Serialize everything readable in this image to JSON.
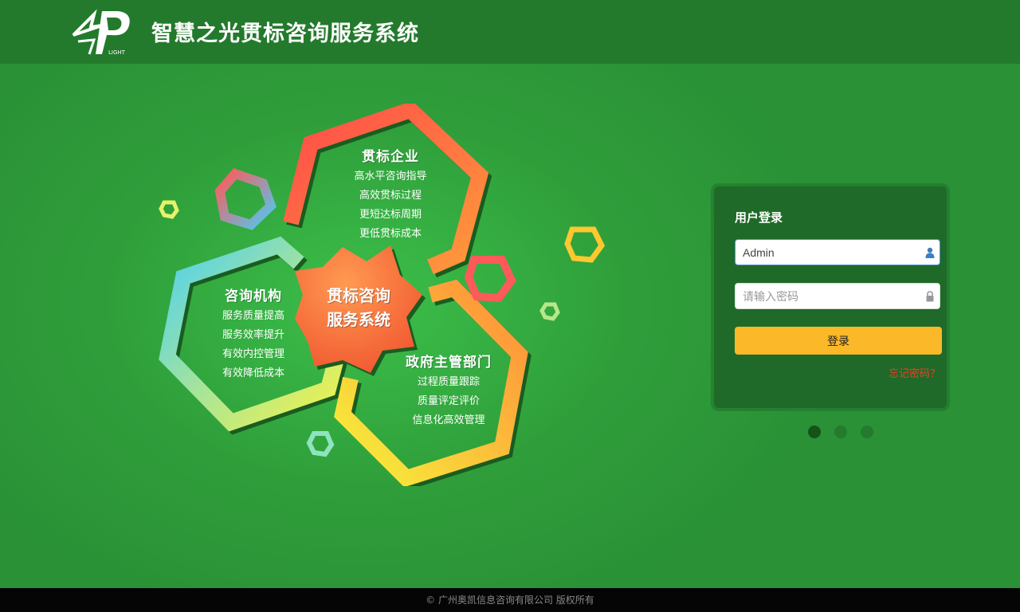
{
  "header": {
    "title": "智慧之光贯标咨询服务系统",
    "logo_text": "LIGHT"
  },
  "illustration": {
    "center": [
      "贯标咨询",
      "服务系统"
    ],
    "groups": [
      {
        "title": "贯标企业",
        "items": [
          "高水平咨询指导",
          "高效贯标过程",
          "更短达标周期",
          "更低贯标成本"
        ]
      },
      {
        "title": "咨询机构",
        "items": [
          "服务质量提高",
          "服务效率提升",
          "有效内控管理",
          "有效降低成本"
        ]
      },
      {
        "title": "政府主管部门",
        "items": [
          "过程质量跟踪",
          "质量评定评价",
          "信息化高效管理"
        ]
      }
    ]
  },
  "login": {
    "title": "用户登录",
    "username_value": "Admin",
    "username_placeholder": "",
    "password_placeholder": "请输入密码",
    "submit_label": "登录",
    "forgot_label": "忘记密码？"
  },
  "carousel": {
    "count": 3,
    "active_index": 0
  },
  "footer": {
    "copyright": "© 广州奥凯信息咨询有限公司 版权所有"
  },
  "colors": {
    "header_bg": "#237a2c",
    "panel_bg": "#1f6a28",
    "button": "#fbb829",
    "link": "#e8402a"
  }
}
